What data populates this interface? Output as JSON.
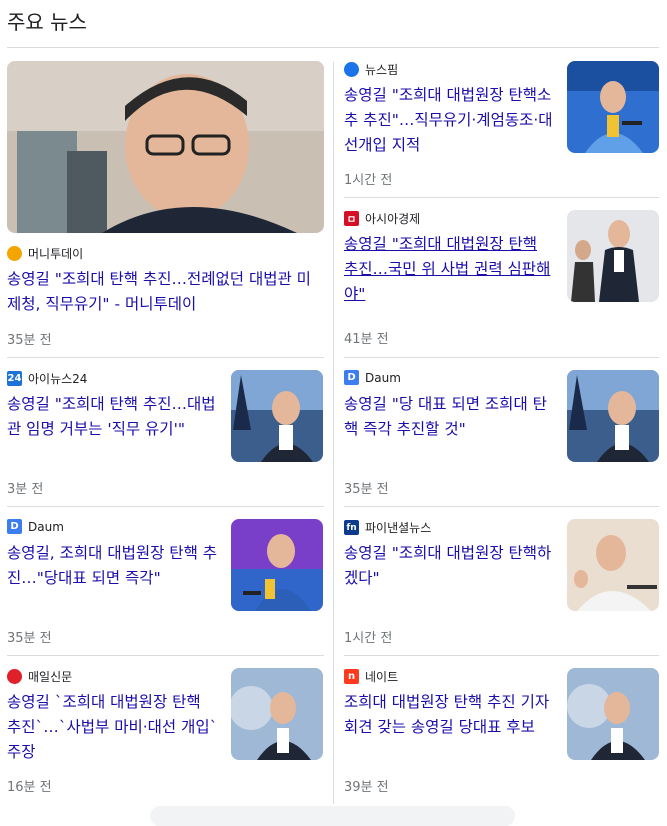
{
  "header": {
    "title": "주요 뉴스"
  },
  "left": [
    {
      "source": "머니투데이",
      "logo_icon": "moneytoday-logo",
      "logo_color": "#f5a500",
      "title": "송영길 \"조희대 탄핵 추진…전례없던 대법관 미제청, 직무유기\" - 머니투데이",
      "time": "35분 전"
    },
    {
      "source": "아이뉴스24",
      "logo_icon": "inews24-logo",
      "logo_color": "#1e73d8",
      "logo_text": "24",
      "title": "송영길 \"조희대 탄핵 추진…대법관 임명 거부는 '직무 유기'\"",
      "time": "3분 전"
    },
    {
      "source": "Daum",
      "logo_icon": "daum-logo",
      "logo_color": "#3c7df0",
      "logo_text": "D",
      "title": "송영길, 조희대 대법원장 탄핵 추진…\"당대표 되면 즉각\"",
      "time": "35분 전"
    },
    {
      "source": "매일신문",
      "logo_icon": "maeil-logo",
      "logo_color": "#e0202a",
      "title": "송영길 `조희대 대법원장 탄핵 추진`…`사법부 마비·대선 개입` 주장",
      "time": "16분 전"
    }
  ],
  "right": [
    {
      "source": "뉴스핌",
      "logo_icon": "newspim-logo",
      "logo_color": "#1a73e8",
      "title": "송영길 \"조희대 대법원장 탄핵소추 추진\"…직무유기·계엄동조·대선개입 지적",
      "time": "1시간 전"
    },
    {
      "source": "아시아경제",
      "logo_icon": "asiae-logo",
      "logo_color": "#d50f25",
      "logo_text": "ㅁ",
      "title": "송영길 \"조희대 대법원장 탄핵 추진…국민 위 사법 권력 심판해야\"",
      "time": "41분 전"
    },
    {
      "source": "Daum",
      "logo_icon": "daum-logo",
      "logo_color": "#3c7df0",
      "logo_text": "D",
      "title": "송영길 \"당 대표 되면 조희대 탄핵 즉각 추진할 것\"",
      "time": "35분 전"
    },
    {
      "source": "파이낸셜뉴스",
      "logo_icon": "fnnews-logo",
      "logo_color": "#0d3c8c",
      "logo_text": "fn",
      "title": "송영길 \"조희대 대법원장 탄핵하겠다\"",
      "time": "1시간 전"
    },
    {
      "source": "네이트",
      "logo_icon": "nate-logo",
      "logo_color": "#ff3b1f",
      "logo_text": "n",
      "title": "조희대 대법원장 탄핵 추진 기자회견 갖는 송영길 당대표 후보",
      "time": "39분 전"
    }
  ]
}
